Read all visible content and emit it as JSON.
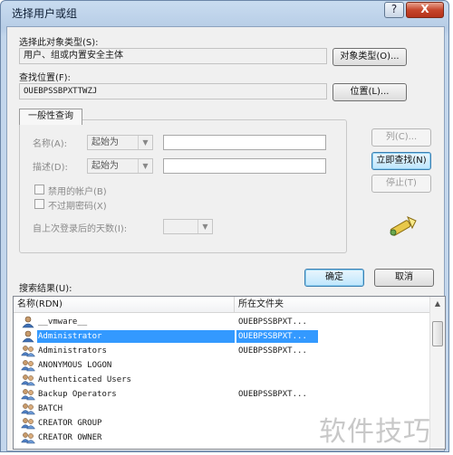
{
  "window": {
    "title": "选择用户或组",
    "help": "?",
    "close": "X"
  },
  "object_type": {
    "label": "选择此对象类型(S):",
    "value": "用户、组或内置安全主体",
    "button": "对象类型(O)..."
  },
  "location": {
    "label": "查找位置(F):",
    "value": "OUEBPSSBPXTTWZJ",
    "button": "位置(L)..."
  },
  "general_query": {
    "tab": "一般性查询",
    "name_label": "名称(A):",
    "name_mode": "起始为",
    "desc_label": "描述(D):",
    "desc_mode": "起始为",
    "disabled_accounts": "禁用的帐户(B)",
    "nonexpiring_password": "不过期密码(X)",
    "days_since_logon": "自上次登录后的天数(I):"
  },
  "side_buttons": {
    "columns": "列(C)...",
    "find_now": "立即查找(N)",
    "stop": "停止(T)"
  },
  "ok": "确定",
  "cancel": "取消",
  "results": {
    "label": "搜索结果(U):",
    "columns": [
      "名称(RDN)",
      "所在文件夹"
    ],
    "rows": [
      {
        "name": "__vmware__",
        "folder": "OUEBPSSBPXT...",
        "icon": "user-icon",
        "selected": false
      },
      {
        "name": "Administrator",
        "folder": "OUEBPSSBPXT...",
        "icon": "user-icon",
        "selected": true
      },
      {
        "name": "Administrators",
        "folder": "OUEBPSSBPXT...",
        "icon": "group-icon",
        "selected": false
      },
      {
        "name": "ANONYMOUS LOGON",
        "folder": "",
        "icon": "group-icon",
        "selected": false
      },
      {
        "name": "Authenticated Users",
        "folder": "",
        "icon": "group-icon",
        "selected": false
      },
      {
        "name": "Backup Operators",
        "folder": "OUEBPSSBPXT...",
        "icon": "group-icon",
        "selected": false
      },
      {
        "name": "BATCH",
        "folder": "",
        "icon": "group-icon",
        "selected": false
      },
      {
        "name": "CREATOR GROUP",
        "folder": "",
        "icon": "group-icon",
        "selected": false
      },
      {
        "name": "CREATOR OWNER",
        "folder": "",
        "icon": "group-icon",
        "selected": false
      }
    ]
  },
  "watermark": "软件技巧"
}
